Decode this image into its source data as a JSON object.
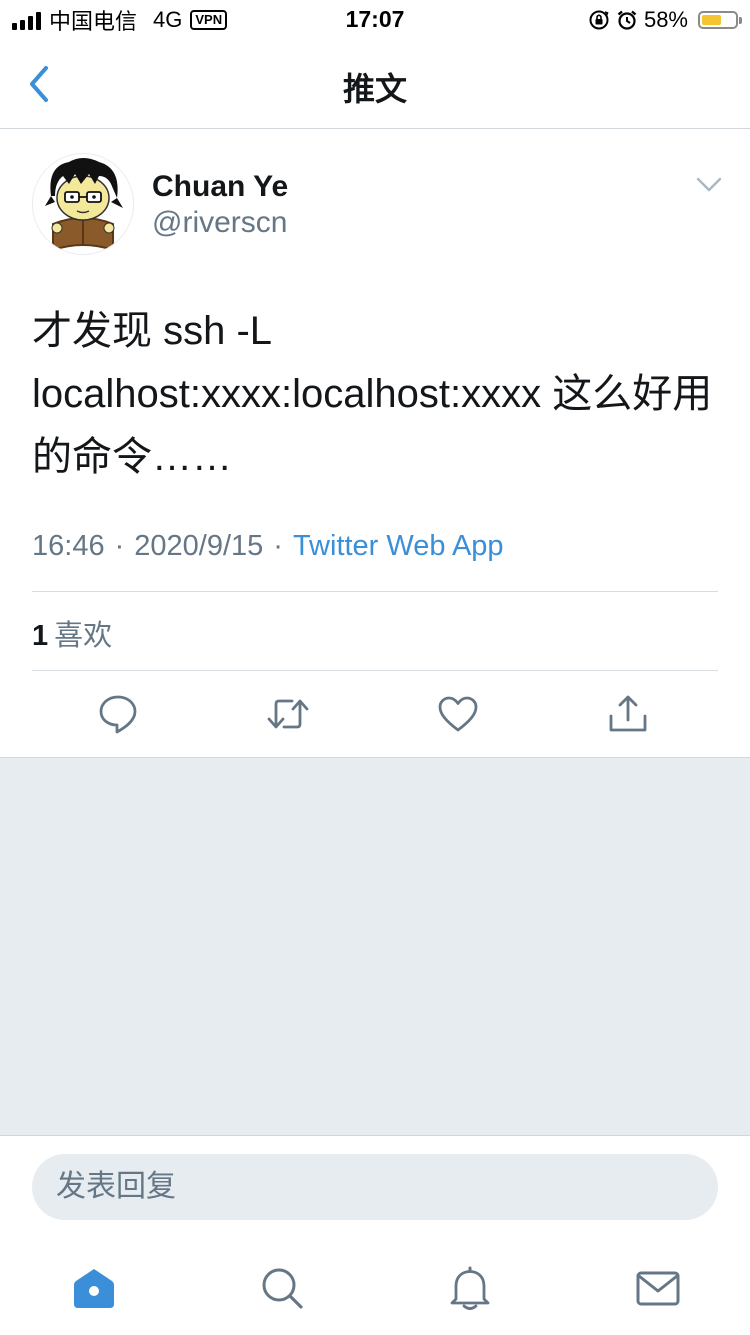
{
  "status_bar": {
    "carrier": "中国电信",
    "network": "4G",
    "vpn": "VPN",
    "time": "17:07",
    "battery_percent": "58%",
    "battery_level": 0.58,
    "battery_color": "#f6c431"
  },
  "nav": {
    "title": "推文",
    "back_icon": "chevron-left-icon"
  },
  "tweet": {
    "author_name": "Chuan Ye",
    "author_handle": "@riverscn",
    "text": "才发现 ssh -L localhost:xxxx:localhost:xxxx 这么好用的命令……",
    "time": "16:46",
    "date": "2020/9/15",
    "separator": "·",
    "source": "Twitter Web App",
    "likes_count": "1",
    "likes_label": "喜欢"
  },
  "actions": [
    "reply-icon",
    "retweet-icon",
    "like-icon",
    "share-icon"
  ],
  "reply": {
    "placeholder": "发表回复"
  },
  "tab_bar": [
    "home-icon",
    "search-icon",
    "notifications-icon",
    "messages-icon"
  ],
  "colors": {
    "accent": "#3b8fd8",
    "secondary_text": "#657786",
    "background_gray": "#e6ecf0"
  }
}
